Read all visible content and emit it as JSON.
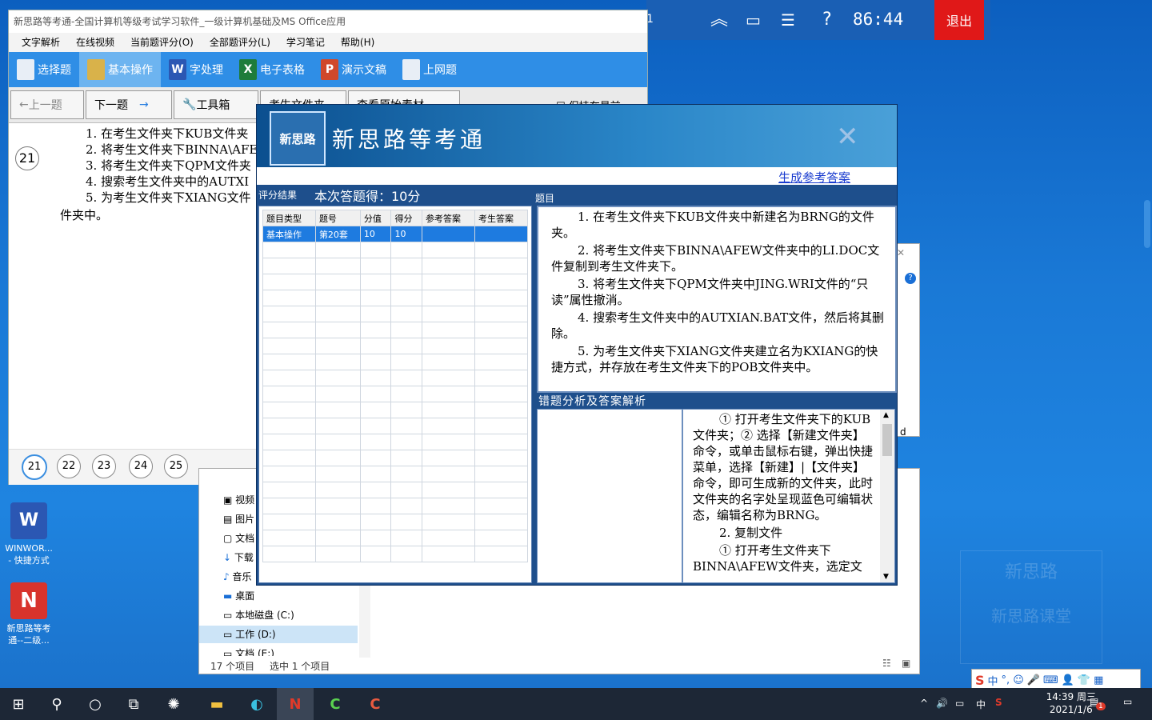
{
  "exam_bar": {
    "timer": "86:44",
    "exit_label": "退出",
    "edge_char": "1"
  },
  "app": {
    "title": "新思路等考通-全国计算机等级考试学习软件_一级计算机基础及MS Office应用",
    "menu": [
      "文字解析",
      "在线视频",
      "当前题评分(O)",
      "全部题评分(L)",
      "学习笔记",
      "帮助(H)"
    ],
    "tabs": [
      "选择题",
      "基本操作",
      "字处理",
      "电子表格",
      "演示文稿",
      "上网题"
    ],
    "tools": {
      "prev": "上一题",
      "next": "下一题",
      "toolbox": "工具箱",
      "hidden1": "考生文件夹",
      "hidden2": "查看原始素材",
      "keep_top": "保持在最前"
    },
    "question_number": "21",
    "questions": [
      "1.  在考生文件夹下KUB文件夹",
      "2.  将考生文件夹下BINNA\\AFE",
      "3.  将考生文件夹下QPM文件夹",
      "4.  搜索考生文件夹中的AUTXI",
      "5.  为考生文件夹下XIANG文件"
    ],
    "questions_tail": "件夹中。",
    "pages": [
      "21",
      "22",
      "23",
      "24",
      "25"
    ]
  },
  "explorer": {
    "tree": [
      "视频",
      "图片",
      "文档",
      "下载",
      "音乐",
      "桌面",
      "本地磁盘 (C:)",
      "工作 (D:)",
      "文档 (E:)"
    ],
    "status_count": "17 个项目",
    "status_selected": "选中 1 个项目",
    "side_char": "d"
  },
  "result_dialog": {
    "brand": "新思路等考通",
    "logo_text": "新思路",
    "link": "生成参考答案",
    "score_header": "评分结果",
    "score_text": "本次答题得：10分",
    "question_header": "题目",
    "grid": {
      "columns": [
        "题目类型",
        "题号",
        "分值",
        "得分",
        "参考答案",
        "考生答案"
      ],
      "rows": [
        [
          "基本操作",
          "第20套",
          "10",
          "10",
          "",
          ""
        ]
      ]
    },
    "question_paragraphs": [
      "1.  在考生文件夹下KUB文件夹中新建名为BRNG的文件夹。",
      "2.  将考生文件夹下BINNA\\AFEW文件夹中的LI.DOC文件复制到考生文件夹下。",
      "3.  将考生文件夹下QPM文件夹中JING.WRI文件的“只读”属性撤消。",
      "4.  搜索考生文件夹中的AUTXIAN.BAT文件，然后将其删除。",
      "5.  为考生文件夹下XIANG文件夹建立名为KXIANG的快捷方式，并存放在考生文件夹下的POB文件夹中。"
    ],
    "analysis_header": "错题分析及答案解析",
    "analysis_paragraphs": [
      "① 打开考生文件夹下的KUB文件夹；② 选择【新建文件夹】命令，或单击鼠标右键，弹出快捷菜单，选择【新建】|【文件夹】命令，即可生成新的文件夹，此时文件夹的名字处呈现蓝色可编辑状态，编辑名称为BRNG。",
      "2. 复制文件",
      "① 打开考生文件夹下BINNA\\AFEW文件夹，选定文"
    ]
  },
  "desktop": {
    "icons": [
      {
        "label": "WINWOR... - 快捷方式"
      },
      {
        "label": "新思路等考通--二级..."
      }
    ],
    "watermark_top": "新思路",
    "watermark_bottom": "新思路课堂"
  },
  "ime": {
    "mode": "中"
  },
  "taskbar": {
    "time": "14:39 周三",
    "date": "2021/1/6",
    "input_lang": "中",
    "notify_count": "1"
  }
}
